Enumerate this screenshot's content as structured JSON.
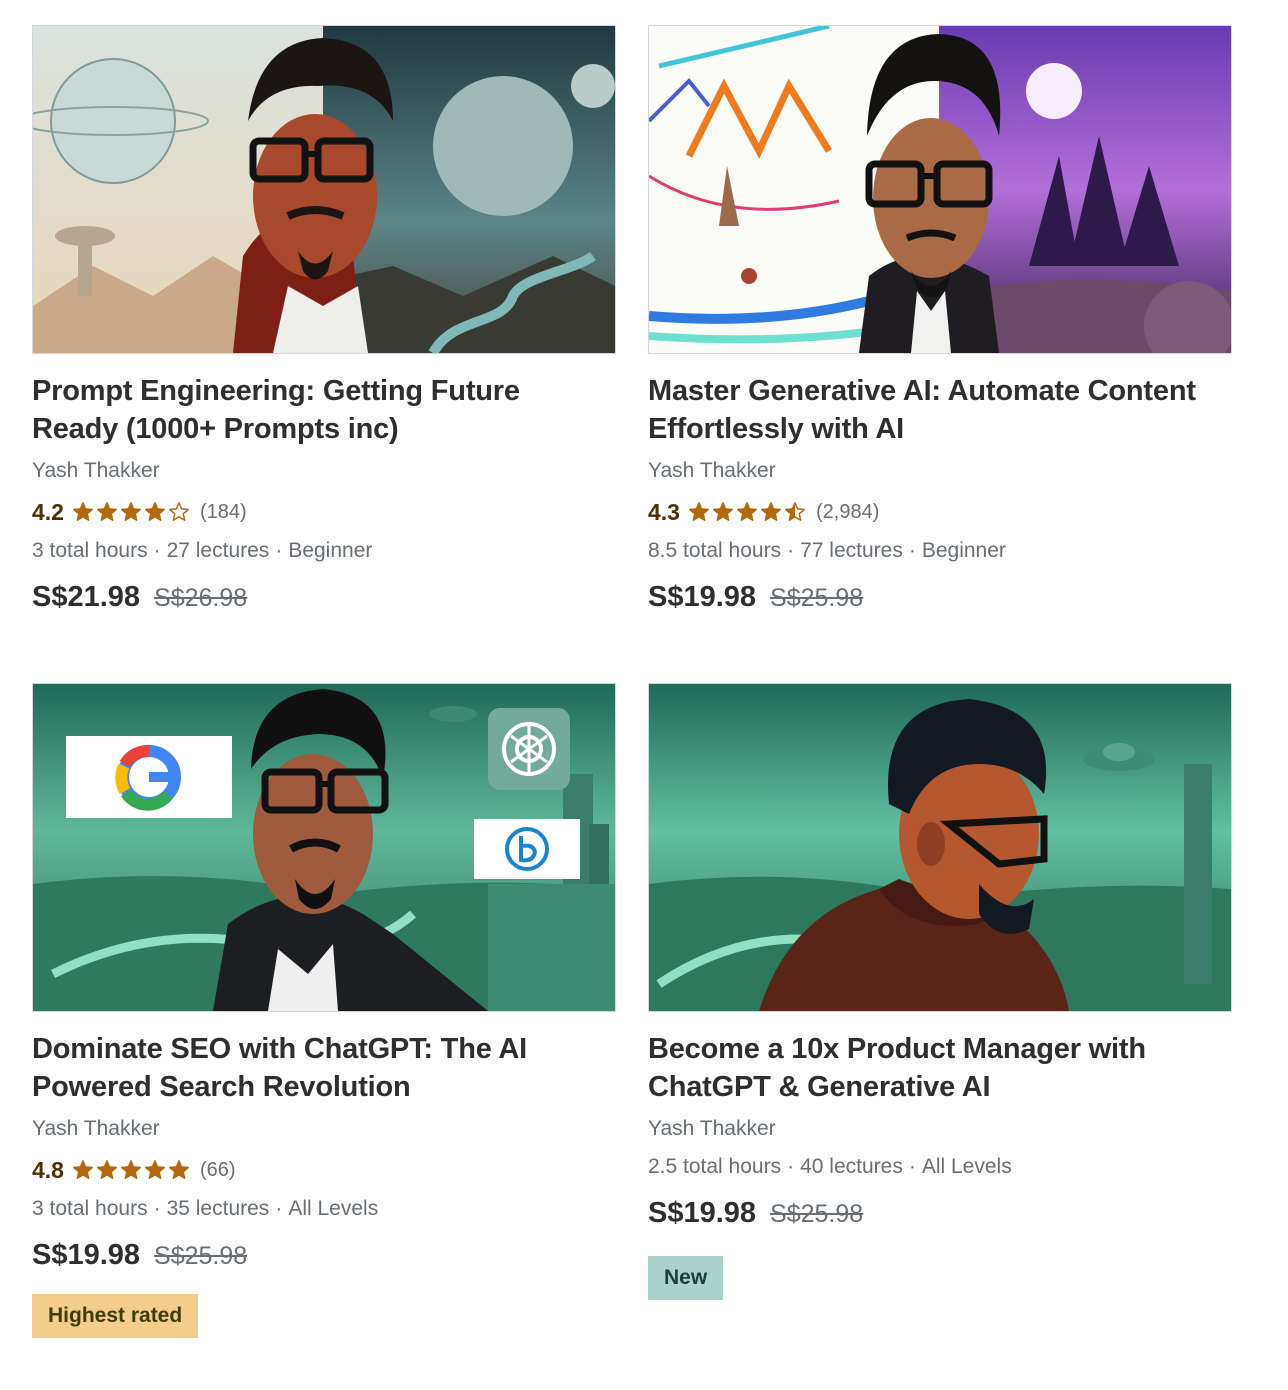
{
  "courses": [
    {
      "title": "Prompt Engineering: Getting Future Ready (1000+ Prompts inc)",
      "instructor": "Yash Thakker",
      "rating": "4.2",
      "stars": 4.2,
      "rating_count": "(184)",
      "hours": "3 total hours",
      "lectures": "27 lectures",
      "level": "Beginner",
      "price": "S$21.98",
      "old_price": "S$26.98",
      "badge": ""
    },
    {
      "title": "Master Generative AI: Automate Content Effortlessly with AI",
      "instructor": "Yash Thakker",
      "rating": "4.3",
      "stars": 4.3,
      "rating_count": "(2,984)",
      "hours": "8.5 total hours",
      "lectures": "77 lectures",
      "level": "Beginner",
      "price": "S$19.98",
      "old_price": "S$25.98",
      "badge": ""
    },
    {
      "title": "Dominate SEO with ChatGPT: The AI Powered Search Revolution",
      "instructor": "Yash Thakker",
      "rating": "4.8",
      "stars": 4.8,
      "rating_count": "(66)",
      "hours": "3 total hours",
      "lectures": "35 lectures",
      "level": "All Levels",
      "price": "S$19.98",
      "old_price": "S$25.98",
      "badge": "Highest rated"
    },
    {
      "title": "Become a 10x Product Manager with ChatGPT & Generative AI",
      "instructor": "Yash Thakker",
      "rating": "",
      "stars": null,
      "rating_count": "",
      "hours": "2.5 total hours",
      "lectures": "40 lectures",
      "level": "All Levels",
      "price": "S$19.98",
      "old_price": "S$25.98",
      "badge": "New"
    }
  ],
  "meta_separator": "·",
  "colors": {
    "star": "#b4690e",
    "rating_text": "#4d3105",
    "highest_rated_badge": "#f2cd8c",
    "new_badge": "#acd2cc"
  }
}
